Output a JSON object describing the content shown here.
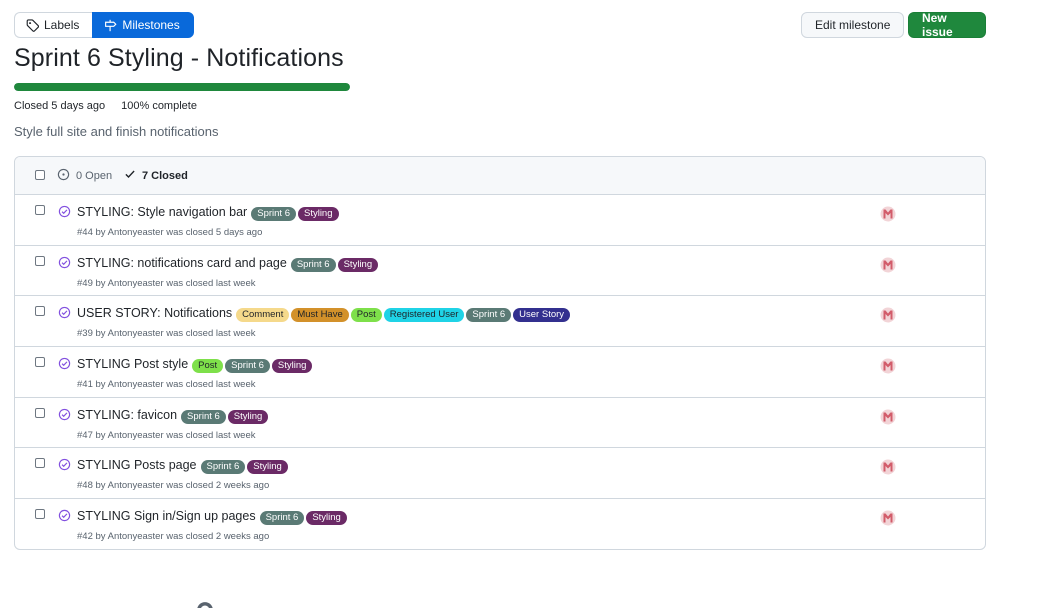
{
  "toolbar": {
    "labels_tab": "Labels",
    "milestones_tab": "Milestones",
    "edit_milestone": "Edit milestone",
    "new_issue": "New issue"
  },
  "milestone": {
    "title": "Sprint 6 Styling - Notifications",
    "progress_fraction": 1.0,
    "closed_text": "Closed 5 days ago",
    "complete_text": "100% complete",
    "description": "Style full site and finish notifications"
  },
  "filters": {
    "open": "0 Open",
    "closed": "7 Closed"
  },
  "colors": {
    "accent": "#0969da",
    "success": "#1f883d",
    "closed_purple": "#8250df"
  },
  "issues": [
    {
      "title": "STYLING: Style navigation bar",
      "meta": "#44 by Antonyeaster was closed 5 days ago",
      "labels": [
        {
          "name": "Sprint 6",
          "bg": "#5a7a75",
          "fg": "#ffffff"
        },
        {
          "name": "Styling",
          "bg": "#6b2a66",
          "fg": "#ffffff"
        }
      ]
    },
    {
      "title": "STYLING: notifications card and page",
      "meta": "#49 by Antonyeaster was closed last week",
      "labels": [
        {
          "name": "Sprint 6",
          "bg": "#5a7a75",
          "fg": "#ffffff"
        },
        {
          "name": "Styling",
          "bg": "#6b2a66",
          "fg": "#ffffff"
        }
      ]
    },
    {
      "title": "USER STORY: Notifications",
      "meta": "#39 by Antonyeaster was closed last week",
      "labels": [
        {
          "name": "Comment",
          "bg": "#f5d98b",
          "fg": "#1f2328"
        },
        {
          "name": "Must Have",
          "bg": "#d3912a",
          "fg": "#1f2328"
        },
        {
          "name": "Post",
          "bg": "#7ee04a",
          "fg": "#1f2328"
        },
        {
          "name": "Registered User",
          "bg": "#1fd3e6",
          "fg": "#1f2328"
        },
        {
          "name": "Sprint 6",
          "bg": "#5a7a75",
          "fg": "#ffffff"
        },
        {
          "name": "User Story",
          "bg": "#33308f",
          "fg": "#ffffff"
        }
      ]
    },
    {
      "title": "STYLING Post style",
      "meta": "#41 by Antonyeaster was closed last week",
      "labels": [
        {
          "name": "Post",
          "bg": "#7ee04a",
          "fg": "#1f2328"
        },
        {
          "name": "Sprint 6",
          "bg": "#5a7a75",
          "fg": "#ffffff"
        },
        {
          "name": "Styling",
          "bg": "#6b2a66",
          "fg": "#ffffff"
        }
      ]
    },
    {
      "title": "STYLING: favicon",
      "meta": "#47 by Antonyeaster was closed last week",
      "labels": [
        {
          "name": "Sprint 6",
          "bg": "#5a7a75",
          "fg": "#ffffff"
        },
        {
          "name": "Styling",
          "bg": "#6b2a66",
          "fg": "#ffffff"
        }
      ]
    },
    {
      "title": "STYLING Posts page",
      "meta": "#48 by Antonyeaster was closed 2 weeks ago",
      "labels": [
        {
          "name": "Sprint 6",
          "bg": "#5a7a75",
          "fg": "#ffffff"
        },
        {
          "name": "Styling",
          "bg": "#6b2a66",
          "fg": "#ffffff"
        }
      ]
    },
    {
      "title": "STYLING Sign in/Sign up pages",
      "meta": "#42 by Antonyeaster was closed 2 weeks ago",
      "labels": [
        {
          "name": "Sprint 6",
          "bg": "#5a7a75",
          "fg": "#ffffff"
        },
        {
          "name": "Styling",
          "bg": "#6b2a66",
          "fg": "#ffffff"
        }
      ]
    }
  ]
}
